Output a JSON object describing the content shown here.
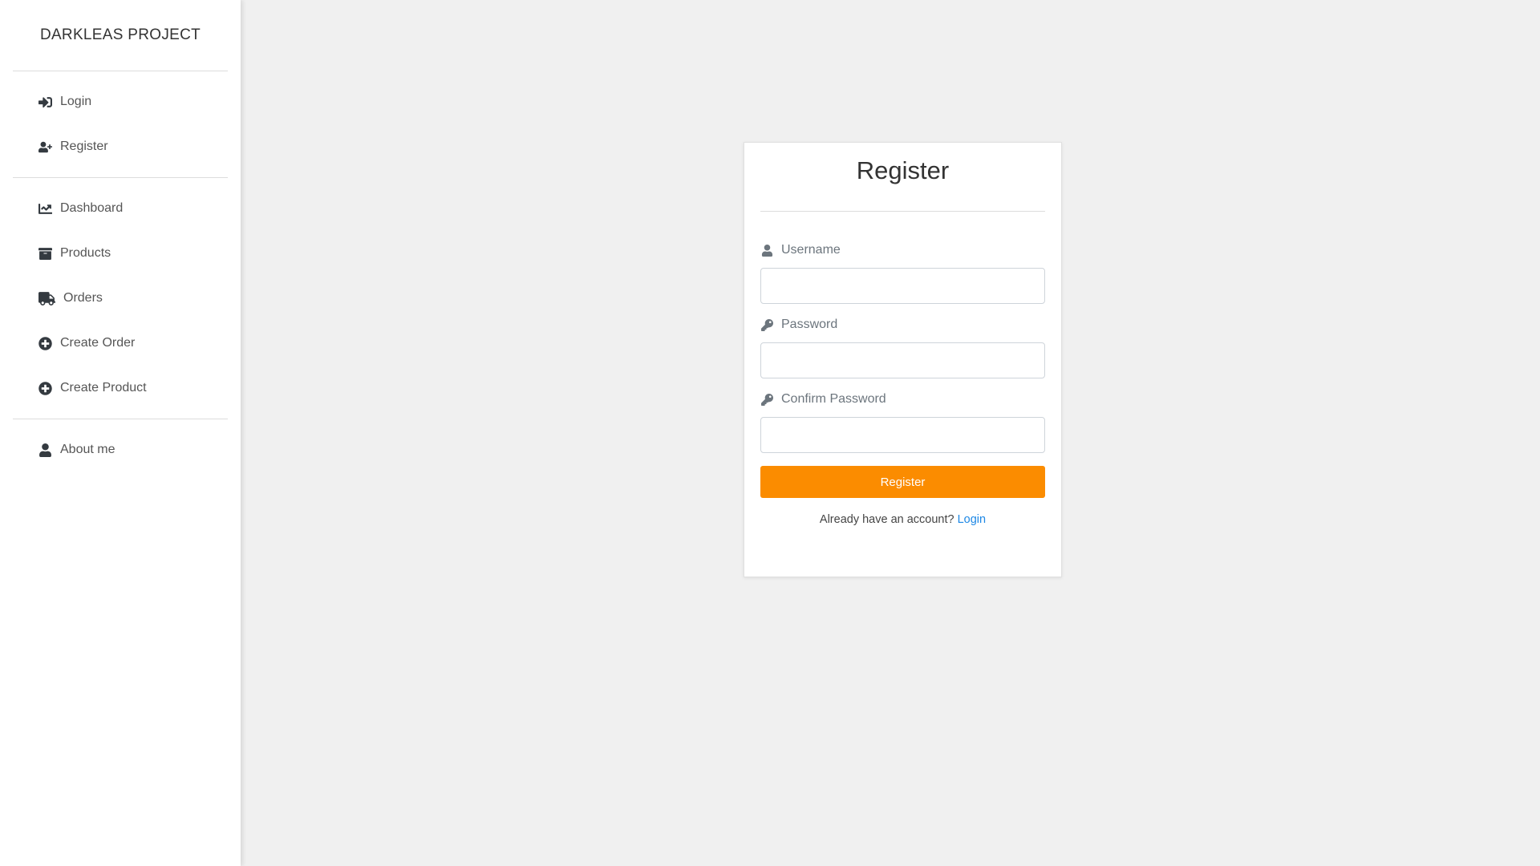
{
  "sidebar": {
    "brand": "DARKLEAS PROJECT",
    "auth_items": [
      {
        "label": "Login",
        "icon": "sign-in-icon"
      },
      {
        "label": "Register",
        "icon": "user-plus-icon"
      }
    ],
    "main_items": [
      {
        "label": "Dashboard",
        "icon": "chart-line-icon"
      },
      {
        "label": "Products",
        "icon": "archive-icon"
      },
      {
        "label": "Orders",
        "icon": "truck-icon"
      },
      {
        "label": "Create Order",
        "icon": "plus-circle-icon"
      },
      {
        "label": "Create Product",
        "icon": "plus-circle-icon"
      }
    ],
    "extra_items": [
      {
        "label": "About me",
        "icon": "user-icon"
      }
    ]
  },
  "register_form": {
    "title": "Register",
    "username_label": "Username",
    "username_value": "",
    "password_label": "Password",
    "password_value": "",
    "confirm_password_label": "Confirm Password",
    "confirm_password_value": "",
    "submit_label": "Register",
    "footer_prompt": "Already have an account?",
    "footer_link": "Login"
  },
  "colors": {
    "accent": "#fb8c00",
    "link": "#1e88e5",
    "background": "#f0f0f0",
    "sidebar_bg": "#ffffff"
  }
}
